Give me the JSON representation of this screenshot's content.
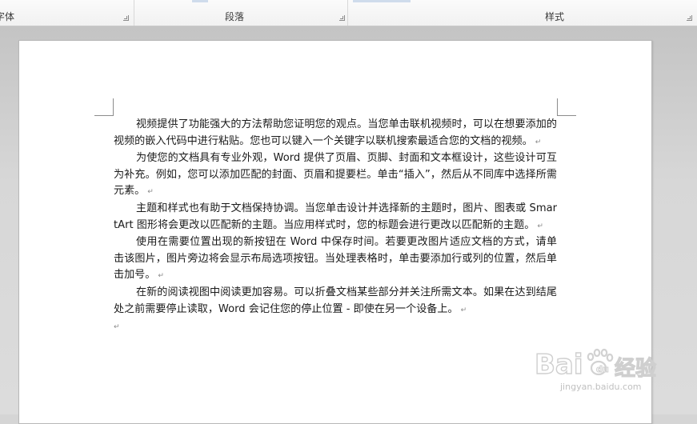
{
  "ribbon": {
    "groups": [
      {
        "label": "字体",
        "launcher": true
      },
      {
        "label": "段落",
        "launcher": true
      },
      {
        "label": "样式",
        "launcher": true
      }
    ]
  },
  "document": {
    "paragraphs": [
      "视频提供了功能强大的方法帮助您证明您的观点。当您单击联机视频时，可以在想要添加的视频的嵌入代码中进行粘贴。您也可以键入一个关键字以联机搜索最适合您的文档的视频。",
      "为使您的文档具有专业外观，Word 提供了页眉、页脚、封面和文本框设计，这些设计可互为补充。例如，您可以添加匹配的封面、页眉和提要栏。单击“插入”，然后从不同库中选择所需元素。",
      "主题和样式也有助于文档保持协调。当您单击设计并选择新的主题时，图片、图表或 SmartArt 图形将会更改以匹配新的主题。当应用样式时，您的标题会进行更改以匹配新的主题。",
      "使用在需要位置出现的新按钮在 Word 中保存时间。若要更改图片适应文档的方式，请单击该图片，图片旁边将会显示布局选项按钮。当处理表格时，单击要添加行或列的位置，然后单击加号。",
      "在新的阅读视图中阅读更加容易。可以折叠文档某些部分并关注所需文本。如果在达到结尾处之前需要停止读取，Word 会记住您的停止位置 - 即使在另一个设备上。"
    ],
    "paragraph_mark": "↵"
  },
  "watermark": {
    "brand": "Baidu经验",
    "url": "jingyan.baidu.com"
  }
}
